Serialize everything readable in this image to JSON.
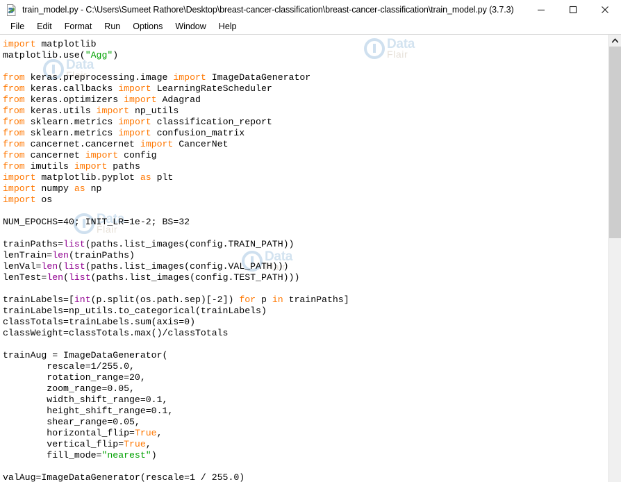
{
  "window": {
    "title": "train_model.py - C:\\Users\\Sumeet Rathore\\Desktop\\breast-cancer-classification\\breast-cancer-classification\\train_model.py (3.7.3)",
    "icon": "python-file-icon",
    "controls": {
      "minimize": "minimize-button",
      "maximize": "maximize-button",
      "close": "close-button"
    }
  },
  "menubar": {
    "items": [
      {
        "label": "File"
      },
      {
        "label": "Edit"
      },
      {
        "label": "Format"
      },
      {
        "label": "Run"
      },
      {
        "label": "Options"
      },
      {
        "label": "Window"
      },
      {
        "label": "Help"
      }
    ]
  },
  "watermark": {
    "primary": "Data",
    "secondary": "Flair"
  },
  "editor": {
    "language": "python",
    "colors": {
      "keyword": "#ff7700",
      "string": "#00a000",
      "builtin": "#900090",
      "definition": "#0000ff",
      "text": "#000000",
      "background": "#ffffff"
    },
    "lines": [
      [
        {
          "t": "import",
          "c": "kw"
        },
        {
          "t": " matplotlib"
        }
      ],
      [
        {
          "t": "matplotlib.use("
        },
        {
          "t": "\"Agg\"",
          "c": "str"
        },
        {
          "t": ")"
        }
      ],
      [],
      [
        {
          "t": "from",
          "c": "kw"
        },
        {
          "t": " keras.preprocessing.image "
        },
        {
          "t": "import",
          "c": "kw"
        },
        {
          "t": " ImageDataGenerator"
        }
      ],
      [
        {
          "t": "from",
          "c": "kw"
        },
        {
          "t": " keras.callbacks "
        },
        {
          "t": "import",
          "c": "kw"
        },
        {
          "t": " LearningRateScheduler"
        }
      ],
      [
        {
          "t": "from",
          "c": "kw"
        },
        {
          "t": " keras.optimizers "
        },
        {
          "t": "import",
          "c": "kw"
        },
        {
          "t": " Adagrad"
        }
      ],
      [
        {
          "t": "from",
          "c": "kw"
        },
        {
          "t": " keras.utils "
        },
        {
          "t": "import",
          "c": "kw"
        },
        {
          "t": " np_utils"
        }
      ],
      [
        {
          "t": "from",
          "c": "kw"
        },
        {
          "t": " sklearn.metrics "
        },
        {
          "t": "import",
          "c": "kw"
        },
        {
          "t": " classification_report"
        }
      ],
      [
        {
          "t": "from",
          "c": "kw"
        },
        {
          "t": " sklearn.metrics "
        },
        {
          "t": "import",
          "c": "kw"
        },
        {
          "t": " confusion_matrix"
        }
      ],
      [
        {
          "t": "from",
          "c": "kw"
        },
        {
          "t": " cancernet.cancernet "
        },
        {
          "t": "import",
          "c": "kw"
        },
        {
          "t": " CancerNet"
        }
      ],
      [
        {
          "t": "from",
          "c": "kw"
        },
        {
          "t": " cancernet "
        },
        {
          "t": "import",
          "c": "kw"
        },
        {
          "t": " config"
        }
      ],
      [
        {
          "t": "from",
          "c": "kw"
        },
        {
          "t": " imutils "
        },
        {
          "t": "import",
          "c": "kw"
        },
        {
          "t": " paths"
        }
      ],
      [
        {
          "t": "import",
          "c": "kw"
        },
        {
          "t": " matplotlib.pyplot "
        },
        {
          "t": "as",
          "c": "kw"
        },
        {
          "t": " plt"
        }
      ],
      [
        {
          "t": "import",
          "c": "kw"
        },
        {
          "t": " numpy "
        },
        {
          "t": "as",
          "c": "kw"
        },
        {
          "t": " np"
        }
      ],
      [
        {
          "t": "import",
          "c": "kw"
        },
        {
          "t": " os"
        }
      ],
      [],
      [
        {
          "t": "NUM_EPOCHS=40; INIT_LR=1e-2; BS=32"
        }
      ],
      [],
      [
        {
          "t": "trainPaths="
        },
        {
          "t": "list",
          "c": "bi"
        },
        {
          "t": "(paths.list_images(config.TRAIN_PATH))"
        }
      ],
      [
        {
          "t": "lenTrain="
        },
        {
          "t": "len",
          "c": "bi"
        },
        {
          "t": "(trainPaths)"
        }
      ],
      [
        {
          "t": "lenVal="
        },
        {
          "t": "len",
          "c": "bi"
        },
        {
          "t": "("
        },
        {
          "t": "list",
          "c": "bi"
        },
        {
          "t": "(paths.list_images(config.VAL_PATH)))"
        }
      ],
      [
        {
          "t": "lenTest="
        },
        {
          "t": "len",
          "c": "bi"
        },
        {
          "t": "("
        },
        {
          "t": "list",
          "c": "bi"
        },
        {
          "t": "(paths.list_images(config.TEST_PATH)))"
        }
      ],
      [],
      [
        {
          "t": "trainLabels=["
        },
        {
          "t": "int",
          "c": "bi"
        },
        {
          "t": "(p.split(os.path.sep)[-2]) "
        },
        {
          "t": "for",
          "c": "kw"
        },
        {
          "t": " p "
        },
        {
          "t": "in",
          "c": "kw"
        },
        {
          "t": " trainPaths]"
        }
      ],
      [
        {
          "t": "trainLabels=np_utils.to_categorical(trainLabels)"
        }
      ],
      [
        {
          "t": "classTotals=trainLabels.sum(axis=0)"
        }
      ],
      [
        {
          "t": "classWeight=classTotals.max()/classTotals"
        }
      ],
      [],
      [
        {
          "t": "trainAug = ImageDataGenerator("
        }
      ],
      [
        {
          "t": "        rescale=1/255.0,"
        }
      ],
      [
        {
          "t": "        rotation_range=20,"
        }
      ],
      [
        {
          "t": "        zoom_range=0.05,"
        }
      ],
      [
        {
          "t": "        width_shift_range=0.1,"
        }
      ],
      [
        {
          "t": "        height_shift_range=0.1,"
        }
      ],
      [
        {
          "t": "        shear_range=0.05,"
        }
      ],
      [
        {
          "t": "        horizontal_flip="
        },
        {
          "t": "True",
          "c": "kw"
        },
        {
          "t": ","
        }
      ],
      [
        {
          "t": "        vertical_flip="
        },
        {
          "t": "True",
          "c": "kw"
        },
        {
          "t": ","
        }
      ],
      [
        {
          "t": "        fill_mode="
        },
        {
          "t": "\"nearest\"",
          "c": "str"
        },
        {
          "t": ")"
        }
      ],
      [],
      [
        {
          "t": "valAug=ImageDataGenerator(rescale=1 / 255.0)"
        }
      ]
    ]
  },
  "scrollbar": {
    "up_arrow": "scroll-up-arrow-icon",
    "thumb_position_percent": 0,
    "thumb_size_percent": 44
  }
}
